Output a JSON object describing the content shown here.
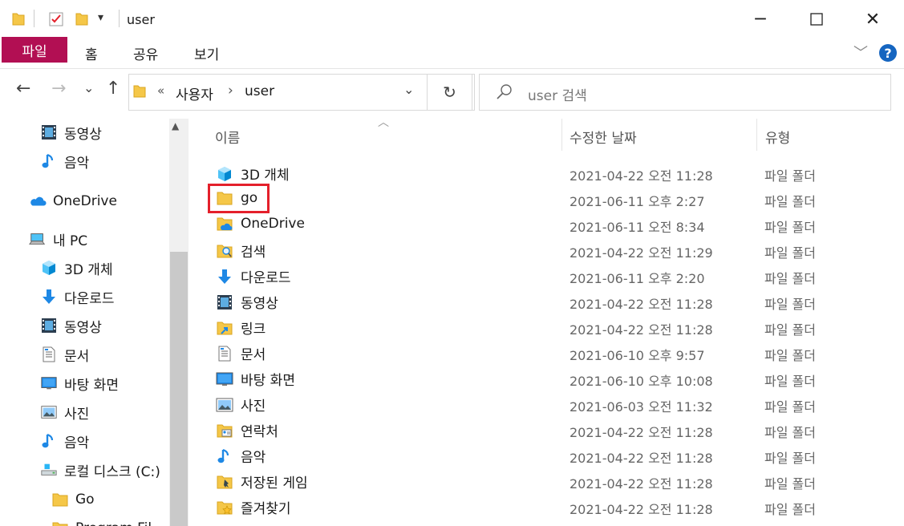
{
  "window": {
    "title": "user",
    "minimize_glyph": "─",
    "maximize_glyph": "☐",
    "close_glyph": "✕",
    "quick_access_dropdown_glyph": "▾"
  },
  "ribbon": {
    "tabs": [
      "파일",
      "홈",
      "공유",
      "보기"
    ],
    "help_glyph": "?",
    "expand_glyph": "﹀"
  },
  "navigation": {
    "back_glyph": "←",
    "forward_glyph": "→",
    "recent_glyph": "⌄",
    "up_glyph": "↑",
    "refresh_glyph": "↻"
  },
  "address": {
    "overflow_glyph": "«",
    "crumbs": [
      "사용자",
      "user"
    ],
    "separator": "›",
    "dropdown_glyph": "⌄"
  },
  "search": {
    "placeholder": "user 검색"
  },
  "nav_pane": {
    "items": [
      {
        "label": "동영상",
        "icon": "video-icon"
      },
      {
        "label": "음악",
        "icon": "music-icon"
      },
      {
        "label": "OneDrive",
        "icon": "onedrive-icon"
      },
      {
        "label": "내 PC",
        "icon": "pc-icon"
      },
      {
        "label": "3D 개체",
        "icon": "3d-objects-icon"
      },
      {
        "label": "다운로드",
        "icon": "download-icon"
      },
      {
        "label": "동영상",
        "icon": "video-icon"
      },
      {
        "label": "문서",
        "icon": "document-icon"
      },
      {
        "label": "바탕 화면",
        "icon": "desktop-icon"
      },
      {
        "label": "사진",
        "icon": "pictures-icon"
      },
      {
        "label": "음악",
        "icon": "music-icon"
      },
      {
        "label": "로컬 디스크 (C:)",
        "icon": "drive-icon"
      },
      {
        "label": "Go",
        "icon": "folder-icon"
      },
      {
        "label": "Program Fil",
        "icon": "folder-icon"
      }
    ]
  },
  "file_list": {
    "sort_indicator": "︿",
    "columns": [
      "이름",
      "수정한 날짜",
      "유형"
    ],
    "rows": [
      {
        "name": "3D 개체",
        "date": "2021-04-22 오전 11:28",
        "type": "파일 폴더",
        "icon": "3d-objects-icon"
      },
      {
        "name": "go",
        "date": "2021-06-11 오후 2:27",
        "type": "파일 폴더",
        "icon": "folder-icon"
      },
      {
        "name": "OneDrive",
        "date": "2021-06-11 오전 8:34",
        "type": "파일 폴더",
        "icon": "onedrive-folder-icon"
      },
      {
        "name": "검색",
        "date": "2021-04-22 오전 11:29",
        "type": "파일 폴더",
        "icon": "search-folder-icon"
      },
      {
        "name": "다운로드",
        "date": "2021-06-11 오후 2:20",
        "type": "파일 폴더",
        "icon": "download-icon"
      },
      {
        "name": "동영상",
        "date": "2021-04-22 오전 11:28",
        "type": "파일 폴더",
        "icon": "video-icon"
      },
      {
        "name": "링크",
        "date": "2021-04-22 오전 11:28",
        "type": "파일 폴더",
        "icon": "links-folder-icon"
      },
      {
        "name": "문서",
        "date": "2021-06-10 오후 9:57",
        "type": "파일 폴더",
        "icon": "document-icon"
      },
      {
        "name": "바탕 화면",
        "date": "2021-06-10 오후 10:08",
        "type": "파일 폴더",
        "icon": "desktop-icon"
      },
      {
        "name": "사진",
        "date": "2021-06-03 오전 11:32",
        "type": "파일 폴더",
        "icon": "pictures-icon"
      },
      {
        "name": "연락처",
        "date": "2021-04-22 오전 11:28",
        "type": "파일 폴더",
        "icon": "contacts-folder-icon"
      },
      {
        "name": "음악",
        "date": "2021-04-22 오전 11:28",
        "type": "파일 폴더",
        "icon": "music-icon"
      },
      {
        "name": "저장된 게임",
        "date": "2021-04-22 오전 11:28",
        "type": "파일 폴더",
        "icon": "saved-games-icon"
      },
      {
        "name": "즐겨찾기",
        "date": "2021-04-22 오전 11:28",
        "type": "파일 폴더",
        "icon": "favorites-folder-icon"
      }
    ]
  },
  "colors": {
    "file_tab": "#b20f53",
    "highlight_box": "#e4202b",
    "folder": "#f5c748",
    "accent_blue": "#1565c0"
  }
}
